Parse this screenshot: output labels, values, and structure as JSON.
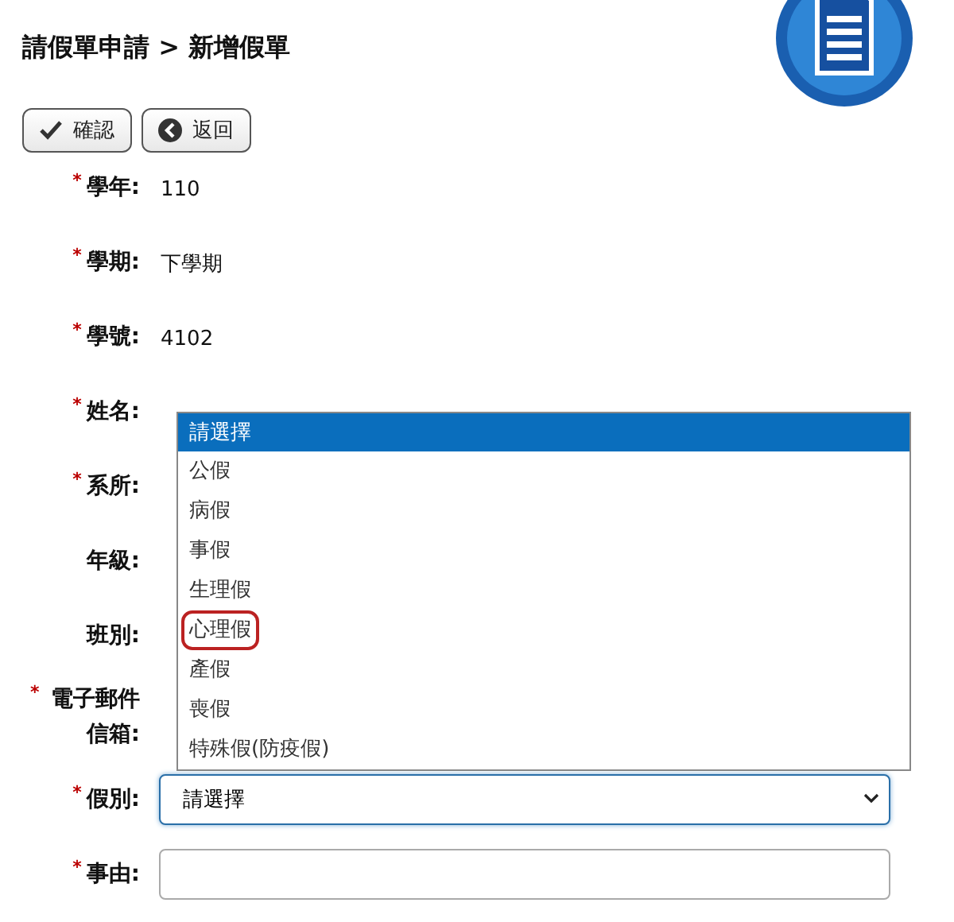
{
  "page": {
    "breadcrumb": "請假單申請 > 新增假單"
  },
  "buttons": [
    {
      "kind": "confirm",
      "label": "確認"
    },
    {
      "kind": "back",
      "label": "返回"
    }
  ],
  "required_mark": "*",
  "fields": [
    {
      "label": "學年:",
      "required": true,
      "kind": "text",
      "value": "110"
    },
    {
      "label": "學期:",
      "required": true,
      "kind": "text",
      "value": "下學期"
    },
    {
      "label": "學號:",
      "required": true,
      "kind": "text",
      "value": "4102"
    },
    {
      "label": "姓名:",
      "required": true,
      "kind": "text"
    },
    {
      "label": "系所:",
      "required": true,
      "kind": "text"
    },
    {
      "label": "年級:",
      "required": false,
      "kind": "text"
    },
    {
      "label": "班別:",
      "required": false,
      "kind": "text"
    },
    {
      "label": "電子郵件信箱:",
      "required": true,
      "kind": "text"
    },
    {
      "label": "假別:",
      "required": true,
      "kind": "select",
      "value": "請選擇",
      "focused": true
    },
    {
      "label": "事由:",
      "required": true,
      "kind": "textarea"
    }
  ],
  "dropdown": {
    "options": [
      {
        "label": "請選擇",
        "selected": true,
        "circled": false
      },
      {
        "label": "公假",
        "selected": false,
        "circled": false
      },
      {
        "label": "病假",
        "selected": false,
        "circled": false
      },
      {
        "label": "事假",
        "selected": false,
        "circled": false
      },
      {
        "label": "生理假",
        "selected": false,
        "circled": false
      },
      {
        "label": "心理假",
        "selected": false,
        "circled": true
      },
      {
        "label": "產假",
        "selected": false,
        "circled": false
      },
      {
        "label": "喪假",
        "selected": false,
        "circled": false
      },
      {
        "label": "特殊假(防疫假)",
        "selected": false,
        "circled": false
      }
    ]
  }
}
